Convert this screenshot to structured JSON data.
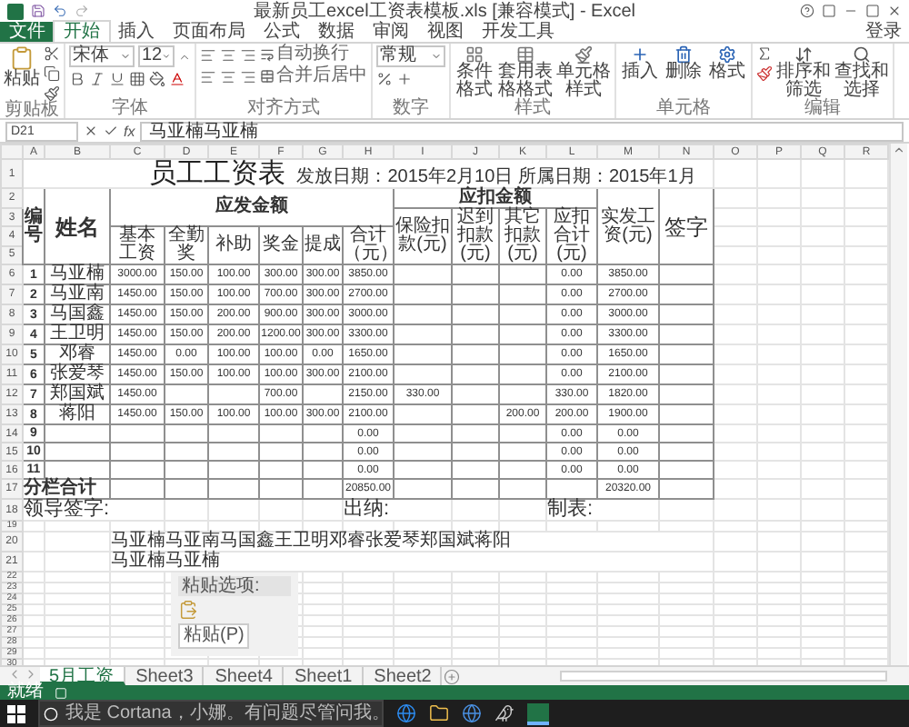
{
  "window": {
    "title": "最新员工excel工资表模板.xls [兼容模式] - Excel"
  },
  "ribbon": {
    "tabs": [
      {
        "label": "文件",
        "kind": "file",
        "selected": false
      },
      {
        "label": "开始",
        "kind": "tab",
        "selected": true
      },
      {
        "label": "插入",
        "kind": "tab",
        "selected": false
      },
      {
        "label": "页面布局",
        "kind": "tab",
        "selected": false
      },
      {
        "label": "公式",
        "kind": "tab",
        "selected": false
      },
      {
        "label": "数据",
        "kind": "tab",
        "selected": false
      },
      {
        "label": "审阅",
        "kind": "tab",
        "selected": false
      },
      {
        "label": "视图",
        "kind": "tab",
        "selected": false
      },
      {
        "label": "开发工具",
        "kind": "tab",
        "selected": false
      }
    ],
    "account": "登录",
    "groups": [
      {
        "kind": "clipboard",
        "label": "剪贴板",
        "paste": "粘贴"
      },
      {
        "kind": "font",
        "label": "字体",
        "font": "宋体",
        "size": "12"
      },
      {
        "kind": "align",
        "label": "对齐方式",
        "wrap": "自动换行",
        "merge": "合并后居中"
      },
      {
        "kind": "number",
        "label": "数字",
        "format": "常规"
      },
      {
        "kind": "styles",
        "label": "样式",
        "buttons": [
          "条件格式",
          "套用表格格式",
          "单元格样式"
        ]
      },
      {
        "kind": "cells",
        "label": "单元格",
        "buttons": [
          "插入",
          "删除",
          "格式"
        ]
      },
      {
        "kind": "editing",
        "label": "编辑",
        "buttons": [
          "排序和筛选",
          "查找和选择"
        ]
      }
    ]
  },
  "formula_bar": {
    "cell": "D21",
    "function_label": "fx",
    "value": "马亚楠马亚楠"
  },
  "columns": [
    "A",
    "B",
    "C",
    "D",
    "E",
    "F",
    "G",
    "H",
    "I",
    "J",
    "K",
    "L",
    "M",
    "N",
    "O",
    "P",
    "Q",
    "R"
  ],
  "row_numbers": [
    "1",
    "2",
    "3",
    "4",
    "5",
    "6",
    "7",
    "8",
    "9",
    "10",
    "11",
    "12",
    "13",
    "14",
    "15",
    "16",
    "17",
    "18",
    "19",
    "20",
    "21",
    "22",
    "23",
    "24",
    "25",
    "26",
    "27",
    "28",
    "29",
    "30"
  ],
  "sheet": {
    "title": "员工工资表",
    "date_line": "发放日期：2015年2月10日 所属日期：2015年1月",
    "headers": {
      "no": "编号",
      "name": "姓名",
      "gross_group": "应发金额",
      "gross": [
        "基本工资",
        "全勤奖",
        "补助",
        "奖金",
        "提成",
        "合计（元）"
      ],
      "deduct_group": "应扣金额",
      "deduct": [
        "保险扣款(元)",
        "迟到扣款(元)",
        "其它扣款(元)",
        "应扣合计(元)"
      ],
      "net": "实发工资(元)",
      "sign": "签字"
    },
    "rows": [
      {
        "A": "1",
        "B": "马亚楠",
        "C": "3000.00",
        "D": "150.00",
        "E": "100.00",
        "F": "300.00",
        "G": "300.00",
        "H": "3850.00",
        "L": "0.00",
        "M": "3850.00"
      },
      {
        "A": "2",
        "B": "马亚南",
        "C": "1450.00",
        "D": "150.00",
        "E": "100.00",
        "F": "700.00",
        "G": "300.00",
        "H": "2700.00",
        "L": "0.00",
        "M": "2700.00"
      },
      {
        "A": "3",
        "B": "马国鑫",
        "C": "1450.00",
        "D": "150.00",
        "E": "200.00",
        "F": "900.00",
        "G": "300.00",
        "H": "3000.00",
        "L": "0.00",
        "M": "3000.00"
      },
      {
        "A": "4",
        "B": "王卫明",
        "C": "1450.00",
        "D": "150.00",
        "E": "200.00",
        "F": "1200.00",
        "G": "300.00",
        "H": "3300.00",
        "L": "0.00",
        "M": "3300.00"
      },
      {
        "A": "5",
        "B": "邓睿",
        "C": "1450.00",
        "D": "0.00",
        "E": "100.00",
        "F": "100.00",
        "G": "0.00",
        "H": "1650.00",
        "L": "0.00",
        "M": "1650.00"
      },
      {
        "A": "6",
        "B": "张爱琴",
        "C": "1450.00",
        "D": "150.00",
        "E": "100.00",
        "F": "100.00",
        "G": "300.00",
        "H": "2100.00",
        "L": "0.00",
        "M": "2100.00"
      },
      {
        "A": "7",
        "B": "郑国斌",
        "C": "1450.00",
        "F": "700.00",
        "H": "2150.00",
        "I": "330.00",
        "L": "330.00",
        "M": "1820.00"
      },
      {
        "A": "8",
        "B": "蒋阳",
        "C": "1450.00",
        "D": "150.00",
        "E": "100.00",
        "F": "100.00",
        "G": "300.00",
        "H": "2100.00",
        "K": "200.00",
        "L": "200.00",
        "M": "1900.00"
      },
      {
        "A": "9",
        "H": "0.00",
        "L": "0.00",
        "M": "0.00"
      },
      {
        "A": "10",
        "H": "0.00",
        "L": "0.00",
        "M": "0.00"
      },
      {
        "A": "11",
        "H": "0.00",
        "L": "0.00",
        "M": "0.00"
      }
    ],
    "total": {
      "A": "分栏合计",
      "H": "20850.00",
      "M": "20320.00"
    },
    "signatures": [
      "领导签字:",
      "出纳:",
      "制表:"
    ],
    "notes": [
      "马亚楠马亚南马国鑫王卫明邓睿张爱琴郑国斌蒋阳",
      "马亚楠马亚楠"
    ]
  },
  "paste_options": {
    "title": "粘贴选项:",
    "button": "粘贴(P)"
  },
  "sheet_tabs": [
    {
      "label": "5月工资",
      "selected": true
    },
    {
      "label": "Sheet3",
      "selected": false
    },
    {
      "label": "Sheet4",
      "selected": false
    },
    {
      "label": "Sheet1",
      "selected": false
    },
    {
      "label": "Sheet2",
      "selected": false
    }
  ],
  "status_bar": {
    "text": "就绪"
  },
  "taskbar": {
    "search": {
      "placeholder": "我是 Cortana，小娜。有问题尽管问我。"
    }
  }
}
